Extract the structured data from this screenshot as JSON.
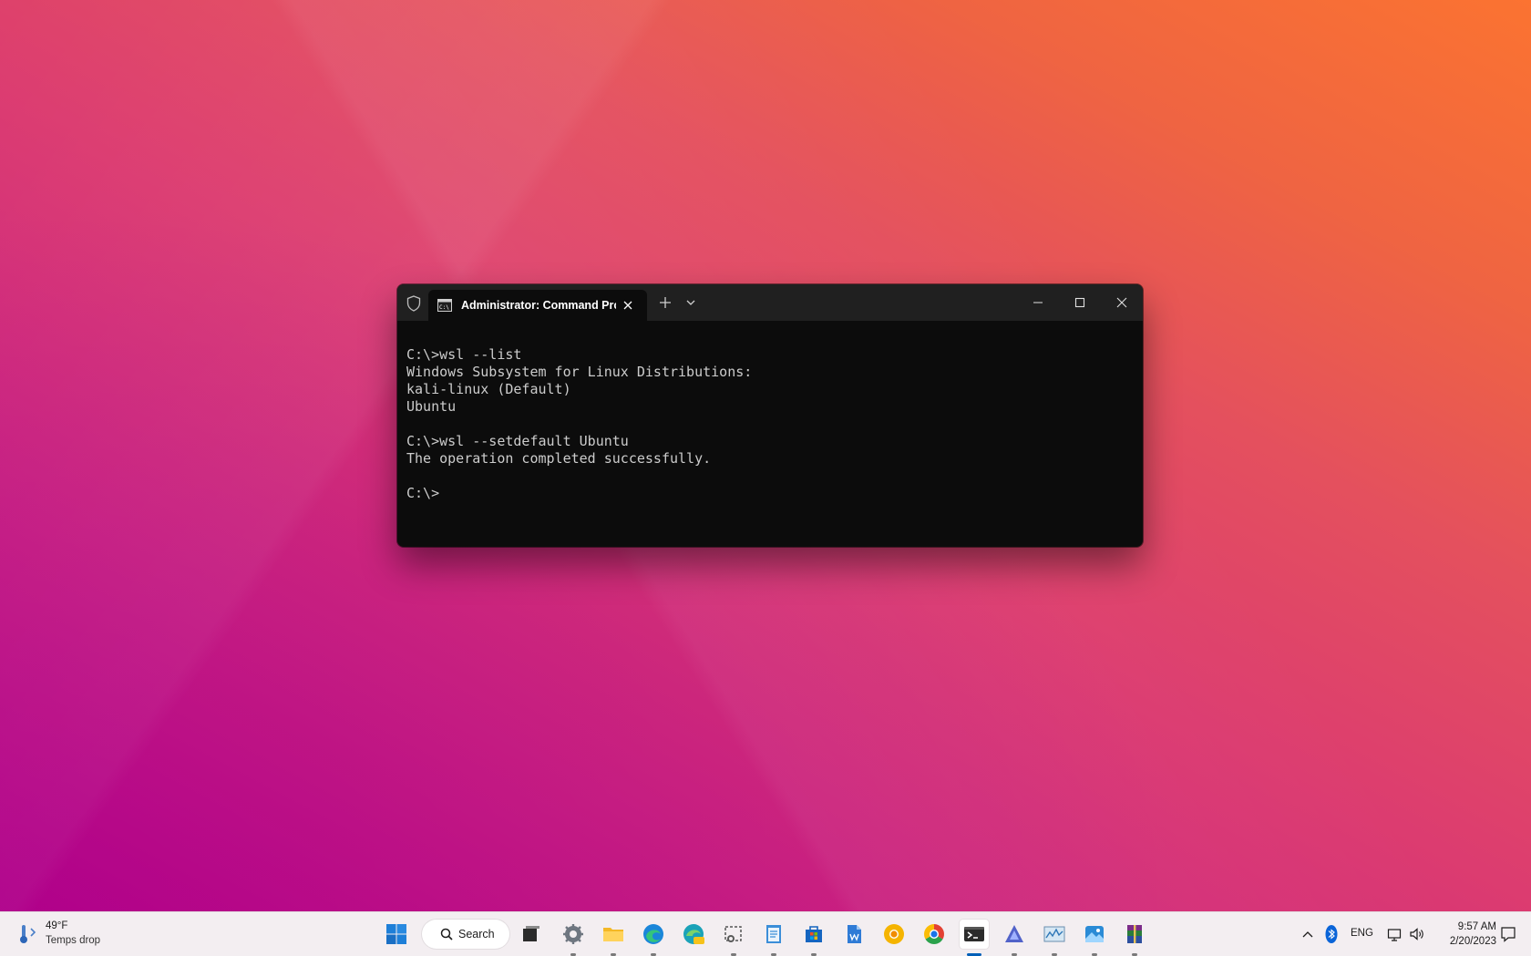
{
  "window": {
    "tab_title": "Administrator: Command Pro",
    "console_lines": [
      "C:\\>wsl --list",
      "Windows Subsystem for Linux Distributions:",
      "kali-linux (Default)",
      "Ubuntu",
      "",
      "C:\\>wsl --setdefault Ubuntu",
      "The operation completed successfully.",
      "",
      "C:\\>"
    ]
  },
  "taskbar": {
    "weather": {
      "temp": "49°F",
      "condition": "Temps drop"
    },
    "search_label": "Search",
    "apps": [
      "start-icon",
      "search",
      "task-view-icon",
      "settings-icon",
      "file-explorer-icon",
      "edge-icon",
      "edge-canary-icon",
      "snipping-tool-icon",
      "notepad-icon",
      "microsoft-store-icon",
      "word-document-icon",
      "chrome-canary-icon",
      "chrome-icon",
      "terminal-icon",
      "affinity-icon",
      "performance-monitor-icon",
      "photos-icon",
      "winrar-icon"
    ],
    "tray": {
      "language": "ENG",
      "time": "9:57 AM",
      "date": "2/20/2023"
    }
  },
  "colors": {
    "desktop_gradient": [
      "#b8008a",
      "#dc3c70",
      "#fb7331"
    ],
    "terminal_bg": "#0c0c0c",
    "titlebar_bg": "#202020",
    "taskbar_bg": "#f3eef1",
    "accent": "#005fb8"
  }
}
